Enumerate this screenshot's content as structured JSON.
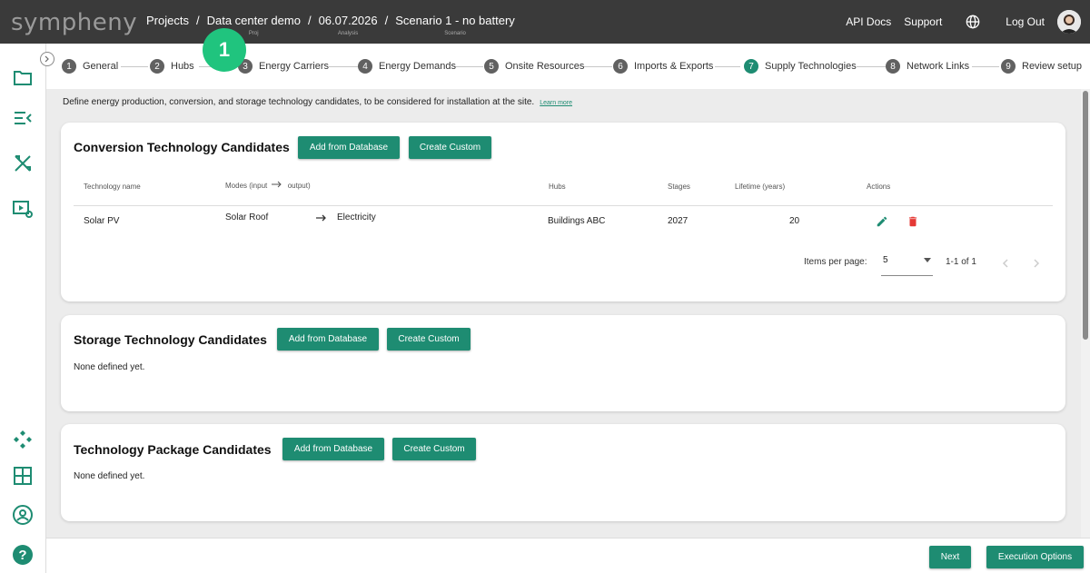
{
  "app": {
    "logo": "sympheny"
  },
  "breadcrumb": [
    {
      "label": "Projects",
      "sub": ""
    },
    {
      "label": "Data center demo",
      "sub": "Proj"
    },
    {
      "label": "06.07.2026",
      "sub": "Analysis"
    },
    {
      "label": "Scenario 1 - no battery",
      "sub": "Scenario"
    }
  ],
  "header": {
    "api_docs": "API Docs",
    "support": "Support",
    "logout": "Log Out"
  },
  "step_badge": "1",
  "steps": [
    {
      "num": "1",
      "label": "General"
    },
    {
      "num": "2",
      "label": "Hubs"
    },
    {
      "num": "3",
      "label": "Energy Carriers"
    },
    {
      "num": "4",
      "label": "Energy Demands"
    },
    {
      "num": "5",
      "label": "Onsite Resources"
    },
    {
      "num": "6",
      "label": "Imports & Exports"
    },
    {
      "num": "7",
      "label": "Supply Technologies"
    },
    {
      "num": "8",
      "label": "Network Links"
    },
    {
      "num": "9",
      "label": "Review setup"
    }
  ],
  "description": {
    "text": "Define energy production, conversion, and storage technology candidates, to be considered for installation at the site.",
    "learn_more": "Learn more"
  },
  "conversion": {
    "title": "Conversion Technology Candidates",
    "add_btn": "Add from Database",
    "custom_btn": "Create Custom",
    "columns": {
      "name": "Technology name",
      "modes": "Modes (input",
      "modes_out": "output)",
      "hubs": "Hubs",
      "stages": "Stages",
      "lifetime": "Lifetime (years)",
      "actions": "Actions"
    },
    "rows": [
      {
        "name": "Solar PV",
        "input": "Solar Roof",
        "output": "Electricity",
        "hubs": "Buildings ABC",
        "stages": "2027",
        "lifetime": "20"
      }
    ],
    "paginator": {
      "label": "Items per page:",
      "per_page": "5",
      "range": "1-1 of 1"
    }
  },
  "storage": {
    "title": "Storage Technology Candidates",
    "add_btn": "Add from Database",
    "custom_btn": "Create Custom",
    "empty": "None defined yet."
  },
  "package": {
    "title": "Technology Package Candidates",
    "add_btn": "Add from Database",
    "custom_btn": "Create Custom",
    "empty": "None defined yet."
  },
  "footer": {
    "next": "Next",
    "exec": "Execution Options"
  },
  "colors": {
    "accent": "#1e8c72",
    "topbar": "#3a3a3a",
    "badge": "#20c47e",
    "delete": "#e53935"
  }
}
